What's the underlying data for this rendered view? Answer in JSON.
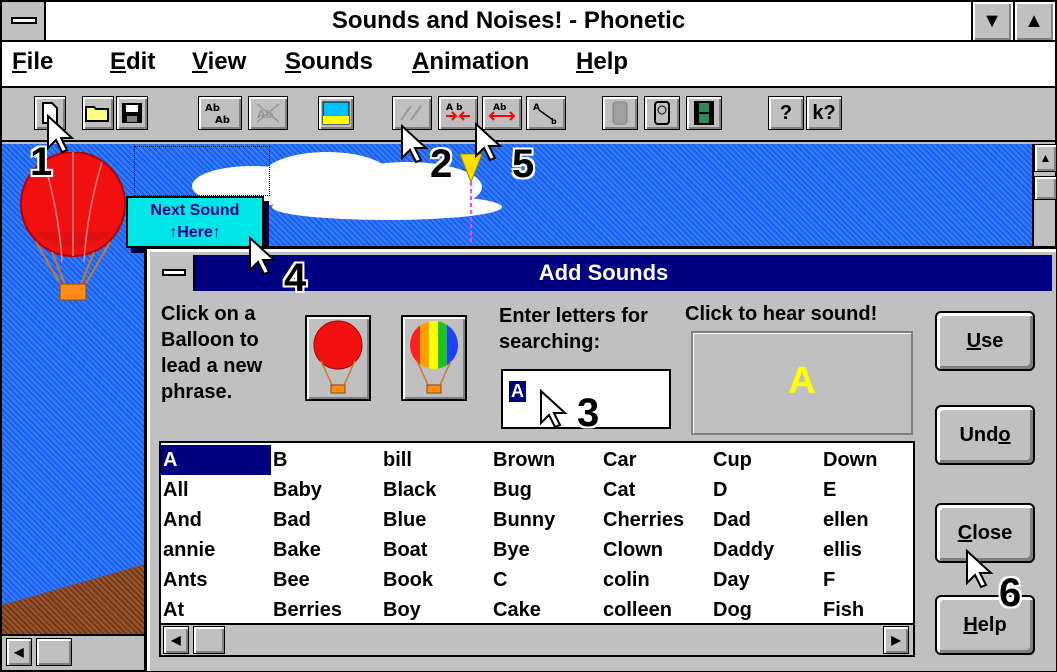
{
  "window": {
    "title": "Sounds and Noises! - Phonetic",
    "min_glyph": "▼",
    "max_glyph": "▲"
  },
  "menu": [
    {
      "mn": "F",
      "rest": "ile"
    },
    {
      "mn": "E",
      "rest": "dit"
    },
    {
      "mn": "V",
      "rest": "iew"
    },
    {
      "mn": "S",
      "rest": "ounds"
    },
    {
      "mn": "A",
      "rest": "nimation"
    },
    {
      "mn": "H",
      "rest": "elp"
    }
  ],
  "toolbar": {
    "new_icon": "new-file-icon",
    "open_icon": "open-folder-icon",
    "save_icon": "save-disk-icon",
    "help_glyph": "?",
    "context_help_glyph": "k?"
  },
  "scene": {
    "next_sound_line1": "Next Sound",
    "next_sound_line2": "↑Here↑"
  },
  "steps": {
    "s1": "1",
    "s2": "2",
    "s3": "3",
    "s4": "4",
    "s5": "5",
    "s6": "6"
  },
  "dialog": {
    "title": "Add Sounds",
    "balloon_label": "Click on a Balloon to lead a new phrase.",
    "search_label": "Enter letters for searching:",
    "search_value": "A",
    "hear_label": "Click to hear sound!",
    "sound_display": "A",
    "buttons": {
      "use": {
        "mn": "U",
        "rest": "se"
      },
      "undo": {
        "pre": "Und",
        "mn": "o"
      },
      "close": {
        "mn": "C",
        "rest": "lose"
      },
      "help": {
        "mn": "H",
        "rest": "elp"
      }
    },
    "word_columns": [
      [
        "A",
        "All",
        "And",
        "annie",
        "Ants",
        "At"
      ],
      [
        "B",
        "Baby",
        "Bad",
        "Bake",
        "Bee",
        "Berries"
      ],
      [
        "bill",
        "Black",
        "Blue",
        "Boat",
        "Book",
        "Boy"
      ],
      [
        "Brown",
        "Bug",
        "Bunny",
        "Bye",
        "C",
        "Cake"
      ],
      [
        "Car",
        "Cat",
        "Cherries",
        "Clown",
        "colin",
        "colleen"
      ],
      [
        "Cup",
        "D",
        "Dad",
        "Daddy",
        "Day",
        "Dog"
      ],
      [
        "Down",
        "E",
        "ellen",
        "ellis",
        "F",
        "Fish"
      ]
    ],
    "selected_word": "A"
  },
  "colors": {
    "sky": "#1660f0",
    "dialog_title": "#000080",
    "next_sound_bg": "#00e6e6",
    "sound_text": "#ffff00"
  }
}
